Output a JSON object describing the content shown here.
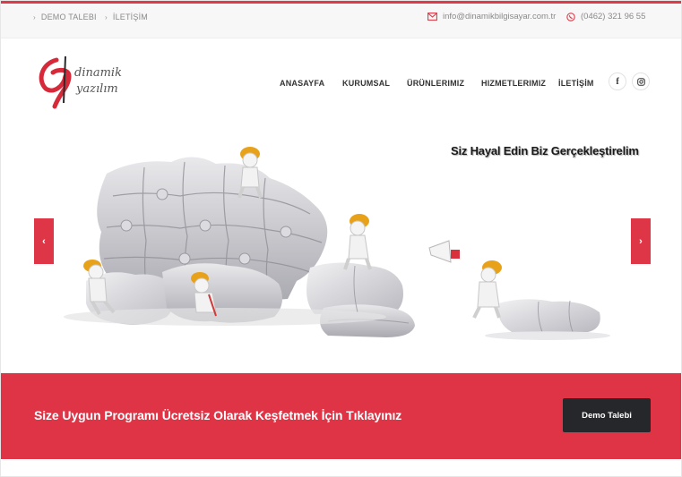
{
  "topbar": {
    "links": [
      {
        "label": "DEMO TALEBI"
      },
      {
        "label": "İLETİŞİM"
      }
    ],
    "email": "info@dinamikbilgisayar.com.tr",
    "phone": "(0462) 321 96 55"
  },
  "brand": {
    "logo_text_line1": "dinamik",
    "logo_text_line2": "yazılım"
  },
  "nav": {
    "items": [
      {
        "label": "ANASAYFA"
      },
      {
        "label": "KURUMSAL"
      },
      {
        "label": "ÜRÜNLERIMIZ"
      },
      {
        "label": "HIZMETLERIMIZ"
      },
      {
        "label": "İLETİŞİM"
      }
    ],
    "social": [
      "facebook-icon",
      "instagram-icon"
    ]
  },
  "slider": {
    "caption": "Siz Hayal Edin Biz Gerçekleştirelim",
    "prev_label": "‹",
    "next_label": "›"
  },
  "cta": {
    "text": "Size Uygun Programı Ücretsiz Olarak Keşfetmek İçin Tıklayınız",
    "button_label": "Demo Talebi"
  },
  "colors": {
    "accent": "#de3446",
    "dark_button": "#26272b",
    "topbar_bg": "#f7f7f7"
  }
}
